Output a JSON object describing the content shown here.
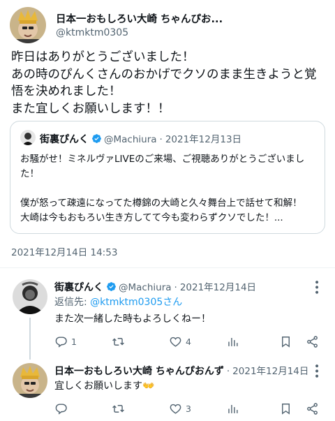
{
  "main_tweet": {
    "author_name": "日本一おもしろい大崎 ちゃんぴお...",
    "author_handle": "@ktmktm0305",
    "text_lines": [
      "昨日はありがとうございました！",
      "あの時のぴんくさんのおかげでクソのまま生きようと覚",
      "悟を決めれました！",
      "また宜しくお願いします！！"
    ],
    "date": "2021年12月14日 14:53"
  },
  "quote": {
    "author_name": "街裏ぴんく",
    "author_handle": "@Machiura",
    "separator": "·",
    "date": "2021年12月13日",
    "text_lines": [
      "お騒がせ！ミネルヴァLIVEのご来場、ご視聴ありがとうございまし",
      "た！",
      "",
      "僕が怒って疎遠になってた樽錦の大崎と久々舞台上で話せて和解！",
      "大崎は今もおもろい生き方してて今も変わらずクソでした！..."
    ]
  },
  "reply1": {
    "author_name": "街裏ぴんく",
    "author_handle": "@Machiura",
    "separator": "·",
    "date": "2021年12月14日",
    "more_icon": "more-icon",
    "reply_to_label": "返信先: ",
    "reply_to_handle": "@ktmktm0305さん",
    "text": "また次一緒した時もよろしくねー！",
    "actions": {
      "reply_count": "1",
      "retweet_count": "",
      "like_count": "4"
    }
  },
  "reply2": {
    "author_name": "日本一おもしろい大崎 ちゃんぴおんず",
    "separator": "·",
    "date": "2021年12月14日",
    "more_icon": "more-icon",
    "text": "宜しくお願いします",
    "emoji": "👐",
    "actions": {
      "reply_count": "",
      "retweet_count": "",
      "like_count": "3"
    }
  },
  "colors": {
    "text": "#0f1419",
    "secondary": "#536471",
    "link": "#1d9bf0",
    "verified": "#1d9bf0",
    "border": "#cfd9de"
  }
}
